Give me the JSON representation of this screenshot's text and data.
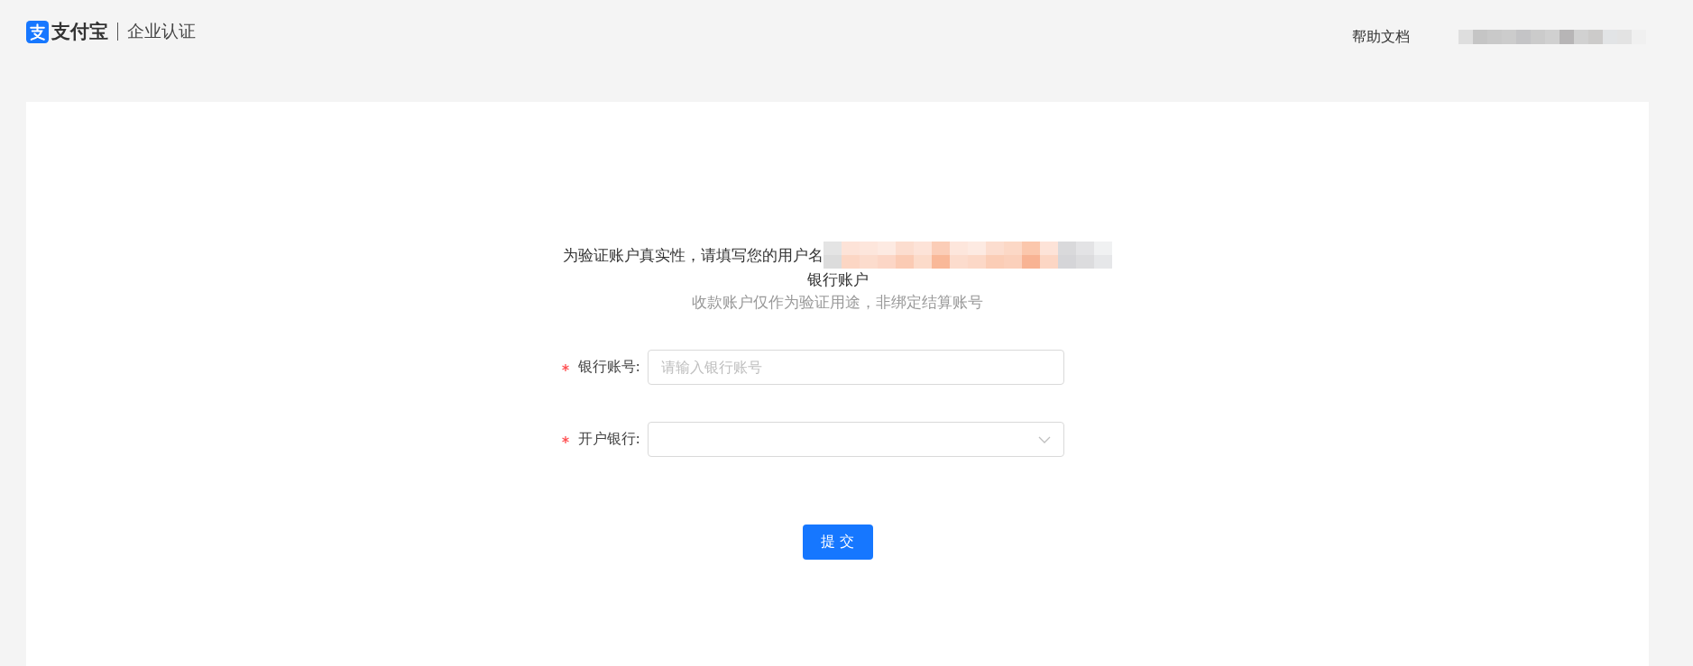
{
  "header": {
    "brand": "支付宝",
    "section": "企业认证",
    "help_link": "帮助文档"
  },
  "form": {
    "intro": "为验证账户真实性，请填写您的用户名",
    "intro_line_2": "银行账户",
    "note": "收款账户仅作为验证用途，非绑定结算账号",
    "fields": [
      {
        "kind": "input",
        "label": "银行账号:",
        "required": true,
        "placeholder": "请输入银行账号"
      },
      {
        "kind": "select",
        "label": "开户银行:",
        "required": true
      }
    ],
    "submit": "提 交"
  }
}
